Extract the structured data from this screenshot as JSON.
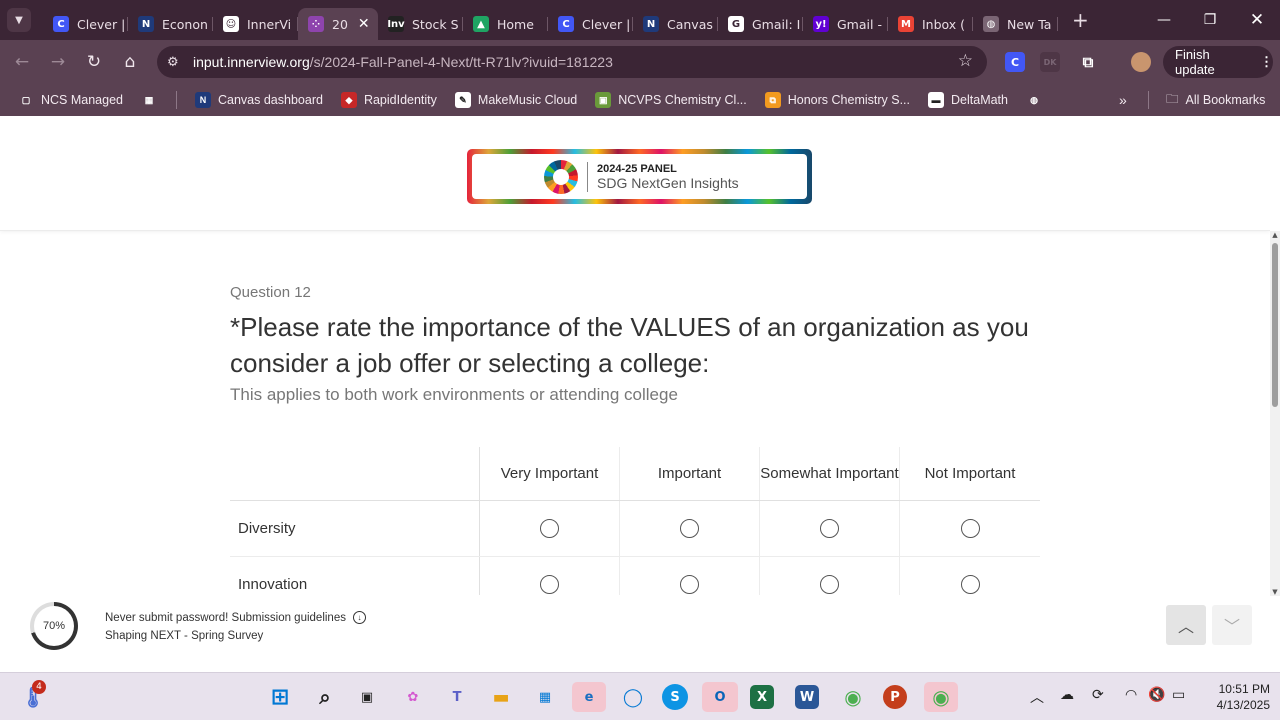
{
  "browser": {
    "tabs": [
      {
        "label": "Clever |",
        "icon": "clever-icon",
        "color": "#4257f5",
        "glyph": "C"
      },
      {
        "label": "Econon",
        "icon": "ncs-icon",
        "color": "#1f3a7a",
        "glyph": "N"
      },
      {
        "label": "InnerVi",
        "icon": "innerview-icon",
        "color": "#ffffff",
        "glyph": "☺"
      },
      {
        "label": "20",
        "icon": "innerview-dots-icon",
        "color": "#8e44ad",
        "glyph": "⁘",
        "active": true
      },
      {
        "label": "Stock S",
        "icon": "investopedia-icon",
        "color": "#222222",
        "glyph": "Inv"
      },
      {
        "label": "Home",
        "icon": "google-drive-icon",
        "color": "#1fa463",
        "glyph": "▲"
      },
      {
        "label": "Clever |",
        "icon": "clever-icon",
        "color": "#4257f5",
        "glyph": "C"
      },
      {
        "label": "Canvas",
        "icon": "ncs-icon",
        "color": "#1f3a7a",
        "glyph": "N"
      },
      {
        "label": "Gmail: I",
        "icon": "google-icon",
        "color": "#ffffff",
        "glyph": "G"
      },
      {
        "label": "Gmail -",
        "icon": "yahoo-icon",
        "color": "#6001d2",
        "glyph": "y!"
      },
      {
        "label": "Inbox (",
        "icon": "gmail-icon",
        "color": "#ea4335",
        "glyph": "M"
      },
      {
        "label": "New Ta",
        "icon": "globe-icon",
        "color": "#7a6574",
        "glyph": "◍"
      }
    ],
    "url_host": "input.innerview.org",
    "url_path": "/s/2024-Fall-Panel-4-Next/tt-R71lv?ivuid=181223",
    "finish_update": "Finish update",
    "bookmarks": [
      {
        "label": "NCS Managed",
        "icon": "managed-folder-icon"
      },
      {
        "label": "",
        "icon": "apps-grid-icon"
      },
      {
        "label": "Canvas dashboard",
        "icon": "ncs-icon"
      },
      {
        "label": "RapidIdentity",
        "icon": "rapididentity-icon"
      },
      {
        "label": "MakeMusic Cloud",
        "icon": "makemusic-icon"
      },
      {
        "label": "NCVPS Chemistry Cl...",
        "icon": "ncvps-icon"
      },
      {
        "label": "Honors Chemistry S...",
        "icon": "sheet-icon"
      },
      {
        "label": "DeltaMath",
        "icon": "deltamath-icon"
      },
      {
        "label": "",
        "icon": "globe-icon"
      }
    ],
    "all_bookmarks": "All Bookmarks"
  },
  "header": {
    "logo_line1": "2024-25 PANEL",
    "logo_line2": "SDG NextGen Insights"
  },
  "question": {
    "number": "Question 12",
    "title": "*Please rate the importance of the VALUES of an organization as you consider a job offer or selecting a college:",
    "subtitle": "This applies to both work environments or attending college",
    "columns": [
      "Very Important",
      "Important",
      "Somewhat Important",
      "Not Important"
    ],
    "rows": [
      "Diversity",
      "Innovation"
    ]
  },
  "footer": {
    "progress_label": "70%",
    "progress_value": 0.7,
    "line1": "Never submit password! Submission guidelines",
    "line2": "Shaping NEXT - Spring Survey"
  },
  "taskbar": {
    "notification_badge": "4",
    "time": "10:51 PM",
    "date": "4/13/2025"
  }
}
